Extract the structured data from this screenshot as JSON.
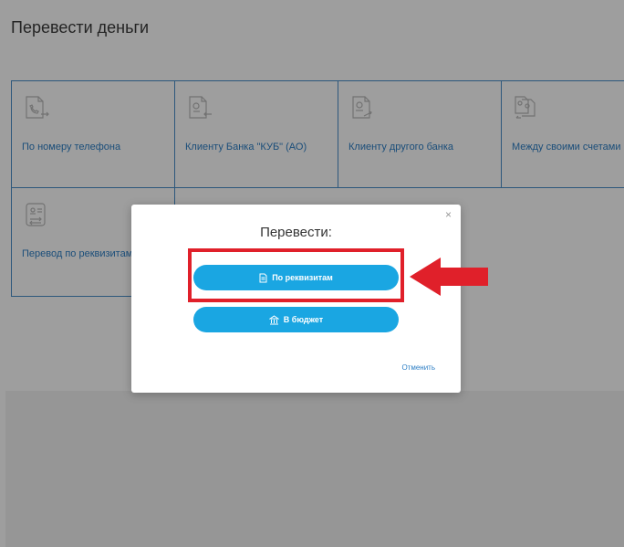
{
  "header": {
    "title": "Перевести деньги"
  },
  "tiles": [
    {
      "label": "По номеру телефона",
      "icon": "phone-transfer-icon"
    },
    {
      "label": "Клиенту Банка \"КУБ\" (АО)",
      "icon": "bank-client-transfer-icon"
    },
    {
      "label": "Клиенту другого банка",
      "icon": "other-bank-transfer-icon"
    },
    {
      "label": "Между своими счетами",
      "icon": "own-accounts-transfer-icon"
    },
    {
      "label": "Перевод по реквизитам",
      "icon": "requisites-transfer-icon"
    }
  ],
  "modal": {
    "title": "Перевести:",
    "close_label": "×",
    "details_button": "По реквизитам",
    "budget_button": "В бюджет",
    "cancel_label": "Отменить"
  },
  "colors": {
    "accent": "#1aa6e2",
    "tile_border": "#4a8fc9",
    "link": "#2c7ec5",
    "highlight": "#e0202a"
  }
}
